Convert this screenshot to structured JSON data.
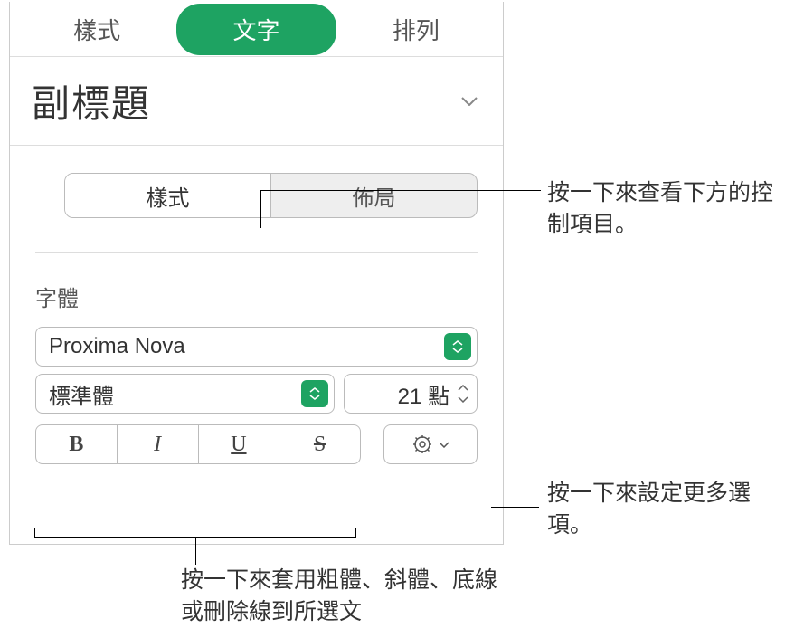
{
  "tabs": {
    "style": "樣式",
    "text": "文字",
    "arrange": "排列"
  },
  "paragraph_style": {
    "label": "副標題"
  },
  "subtabs": {
    "style": "樣式",
    "layout": "佈局"
  },
  "font": {
    "section_label": "字體",
    "family": "Proxima Nova",
    "weight": "標準體",
    "size": "21 點"
  },
  "format_buttons": {
    "bold": "B",
    "italic": "I",
    "underline": "U",
    "strike": "S"
  },
  "callouts": {
    "layout_hint": "按一下來查看下方的控制項目。",
    "gear_hint": "按一下來設定更多選項。",
    "format_hint": "按一下來套用粗體、斜體、底線或刪除線到所選文"
  }
}
